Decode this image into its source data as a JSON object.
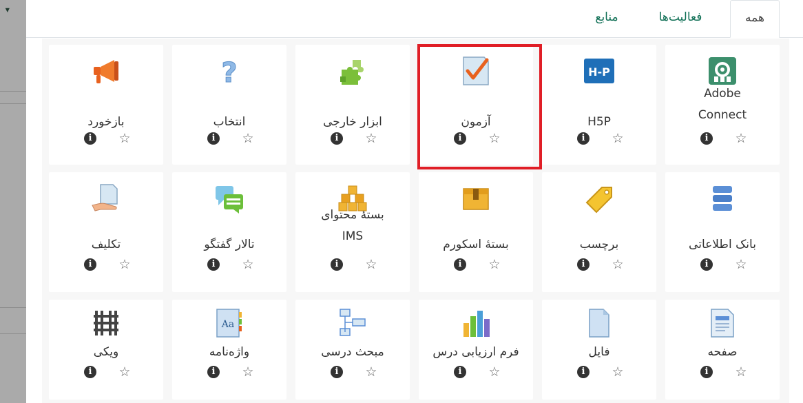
{
  "tabs": [
    {
      "label": "همه",
      "active": true
    },
    {
      "label": "فعالیت‌ها",
      "active": false
    },
    {
      "label": "منابع",
      "active": false
    }
  ],
  "rows": [
    [
      {
        "name": "Adobe Connect",
        "icon": "adobe-connect-icon"
      },
      {
        "name": "H5P",
        "icon": "h5p-icon"
      },
      {
        "name": "آزمون",
        "icon": "quiz-icon",
        "highlighted": true
      },
      {
        "name": "ابزار خارجی",
        "icon": "puzzle-icon"
      },
      {
        "name": "انتخاب",
        "icon": "question-icon"
      },
      {
        "name": "بازخورد",
        "icon": "megaphone-icon"
      }
    ],
    [
      {
        "name": "بانک اطلاعاتی",
        "icon": "database-icon"
      },
      {
        "name": "برچسب",
        "icon": "tag-icon"
      },
      {
        "name": "بستهٔ اسکورم",
        "icon": "package-icon"
      },
      {
        "name": "بستهٔ محتوای IMS",
        "icon": "boxes-icon"
      },
      {
        "name": "تالار گفتگو",
        "icon": "forum-icon"
      },
      {
        "name": "تکلیف",
        "icon": "assignment-icon"
      }
    ],
    [
      {
        "name": "صفحه",
        "icon": "page-icon"
      },
      {
        "name": "فایل",
        "icon": "file-icon"
      },
      {
        "name": "فرم ارزیابی درس",
        "icon": "bar-chart-icon"
      },
      {
        "name": "مبحث درسی",
        "icon": "lesson-icon"
      },
      {
        "name": "واژه‌نامه",
        "icon": "glossary-icon"
      },
      {
        "name": "ویکی",
        "icon": "wiki-icon"
      }
    ]
  ],
  "colors": {
    "tab_link": "#0f6f55",
    "highlight": "#e01e26",
    "tile_bg": "#ffffff",
    "grid_bg": "#f7f7f7"
  }
}
